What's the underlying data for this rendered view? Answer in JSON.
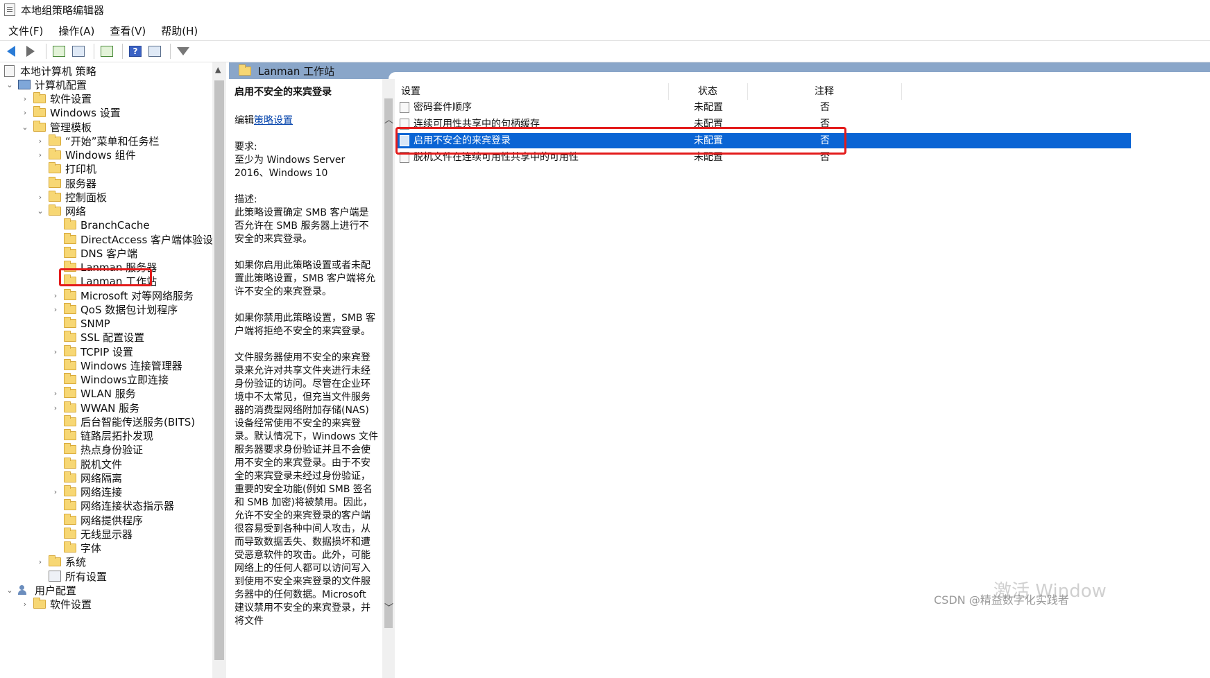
{
  "window": {
    "title": "本地组策略编辑器"
  },
  "menu": [
    "文件(F)",
    "操作(A)",
    "查看(V)",
    "帮助(H)"
  ],
  "toolbar": {
    "icons": [
      "back-arrow-icon",
      "forward-arrow-icon",
      "up-folder-icon",
      "show-hide-tree-icon",
      "export-list-icon",
      "help-icon",
      "properties-icon",
      "filter-icon"
    ]
  },
  "tree": {
    "items": [
      {
        "label": "本地计算机 策略",
        "level": 0,
        "icon": "policy-doc-icon",
        "chevron": ""
      },
      {
        "label": "计算机配置",
        "level": 1,
        "icon": "computer-icon",
        "chevron": "⌄"
      },
      {
        "label": "软件设置",
        "level": 2,
        "icon": "folder-icon",
        "chevron": "›"
      },
      {
        "label": "Windows 设置",
        "level": 2,
        "icon": "folder-icon",
        "chevron": "›"
      },
      {
        "label": "管理模板",
        "level": 2,
        "icon": "folder-icon",
        "chevron": "⌄"
      },
      {
        "label": "“开始”菜单和任务栏",
        "level": 3,
        "icon": "folder-icon",
        "chevron": "›"
      },
      {
        "label": "Windows 组件",
        "level": 3,
        "icon": "folder-icon",
        "chevron": "›"
      },
      {
        "label": "打印机",
        "level": 3,
        "icon": "folder-icon",
        "chevron": ""
      },
      {
        "label": "服务器",
        "level": 3,
        "icon": "folder-icon",
        "chevron": ""
      },
      {
        "label": "控制面板",
        "level": 3,
        "icon": "folder-icon",
        "chevron": "›"
      },
      {
        "label": "网络",
        "level": 3,
        "icon": "folder-icon",
        "chevron": "⌄"
      },
      {
        "label": "BranchCache",
        "level": 4,
        "icon": "folder-icon",
        "chevron": ""
      },
      {
        "label": "DirectAccess 客户端体验设置",
        "level": 4,
        "icon": "folder-icon",
        "chevron": ""
      },
      {
        "label": "DNS 客户端",
        "level": 4,
        "icon": "folder-icon",
        "chevron": ""
      },
      {
        "label": "Lanman 服务器",
        "level": 4,
        "icon": "folder-icon",
        "chevron": ""
      },
      {
        "label": "Lanman 工作站",
        "level": 4,
        "icon": "folder-icon",
        "chevron": "",
        "selected": true
      },
      {
        "label": "Microsoft 对等网络服务",
        "level": 4,
        "icon": "folder-icon",
        "chevron": "›"
      },
      {
        "label": "QoS 数据包计划程序",
        "level": 4,
        "icon": "folder-icon",
        "chevron": "›"
      },
      {
        "label": "SNMP",
        "level": 4,
        "icon": "folder-icon",
        "chevron": ""
      },
      {
        "label": "SSL 配置设置",
        "level": 4,
        "icon": "folder-icon",
        "chevron": ""
      },
      {
        "label": "TCPIP 设置",
        "level": 4,
        "icon": "folder-icon",
        "chevron": "›"
      },
      {
        "label": "Windows 连接管理器",
        "level": 4,
        "icon": "folder-icon",
        "chevron": ""
      },
      {
        "label": "Windows立即连接",
        "level": 4,
        "icon": "folder-icon",
        "chevron": ""
      },
      {
        "label": "WLAN 服务",
        "level": 4,
        "icon": "folder-icon",
        "chevron": "›"
      },
      {
        "label": "WWAN 服务",
        "level": 4,
        "icon": "folder-icon",
        "chevron": "›"
      },
      {
        "label": "后台智能传送服务(BITS)",
        "level": 4,
        "icon": "folder-icon",
        "chevron": ""
      },
      {
        "label": "链路层拓扑发现",
        "level": 4,
        "icon": "folder-icon",
        "chevron": ""
      },
      {
        "label": "热点身份验证",
        "level": 4,
        "icon": "folder-icon",
        "chevron": ""
      },
      {
        "label": "脱机文件",
        "level": 4,
        "icon": "folder-icon",
        "chevron": ""
      },
      {
        "label": "网络隔离",
        "level": 4,
        "icon": "folder-icon",
        "chevron": ""
      },
      {
        "label": "网络连接",
        "level": 4,
        "icon": "folder-icon",
        "chevron": "›"
      },
      {
        "label": "网络连接状态指示器",
        "level": 4,
        "icon": "folder-icon",
        "chevron": ""
      },
      {
        "label": "网络提供程序",
        "level": 4,
        "icon": "folder-icon",
        "chevron": ""
      },
      {
        "label": "无线显示器",
        "level": 4,
        "icon": "folder-icon",
        "chevron": ""
      },
      {
        "label": "字体",
        "level": 4,
        "icon": "folder-icon",
        "chevron": ""
      },
      {
        "label": "系统",
        "level": 3,
        "icon": "folder-icon",
        "chevron": "›"
      },
      {
        "label": "所有设置",
        "level": 3,
        "icon": "all-settings-icon",
        "chevron": ""
      },
      {
        "label": "用户配置",
        "level": 1,
        "icon": "users-icon",
        "chevron": "⌄"
      },
      {
        "label": "软件设置",
        "level": 2,
        "icon": "folder-icon",
        "chevron": "›"
      }
    ]
  },
  "right": {
    "header_title": "Lanman 工作站",
    "description": {
      "title": "启用不安全的来宾登录",
      "edit_prefix": "编辑",
      "edit_link": "策略设置",
      "requirement_label": "要求:",
      "requirement": "至少为 Windows Server 2016、Windows 10",
      "desc_label": "描述:",
      "p1": "此策略设置确定 SMB 客户端是否允许在 SMB 服务器上进行不安全的来宾登录。",
      "p2": "如果你启用此策略设置或者未配置此策略设置，SMB 客户端将允许不安全的来宾登录。",
      "p3": "如果你禁用此策略设置，SMB 客户端将拒绝不安全的来宾登录。",
      "p4": "文件服务器使用不安全的来宾登录来允许对共享文件夹进行未经身份验证的访问。尽管在企业环境中不太常见，但充当文件服务器的消费型网络附加存储(NAS)设备经常使用不安全的来宾登录。默认情况下，Windows 文件服务器要求身份验证并且不会使用不安全的来宾登录。由于不安全的来宾登录未经过身份验证，重要的安全功能(例如 SMB 签名和 SMB 加密)将被禁用。因此，允许不安全的来宾登录的客户端很容易受到各种中间人攻击，从而导致数据丢失、数据损坏和遭受恶意软件的攻击。此外，可能网络上的任何人都可以访问写入到使用不安全来宾登录的文件服务器中的任何数据。Microsoft 建议禁用不安全的来宾登录，并将文件"
    },
    "columns": [
      "设置",
      "状态",
      "注释"
    ],
    "rows": [
      {
        "setting": "密码套件顺序",
        "state": "未配置",
        "comment": "否"
      },
      {
        "setting": "连续可用性共享中的句柄缓存",
        "state": "未配置",
        "comment": "否"
      },
      {
        "setting": "启用不安全的来宾登录",
        "state": "未配置",
        "comment": "否",
        "selected": true
      },
      {
        "setting": "脱机文件在连续可用性共享中的可用性",
        "state": "未配置",
        "comment": "否"
      }
    ]
  },
  "watermarks": {
    "activate": "激活 Window",
    "csdn": "CSDN @精益数字化实践者"
  },
  "colors": {
    "selection": "#0a64d4",
    "highlight_outline": "#e31b1b",
    "pane_header": "#8aa6c9"
  }
}
